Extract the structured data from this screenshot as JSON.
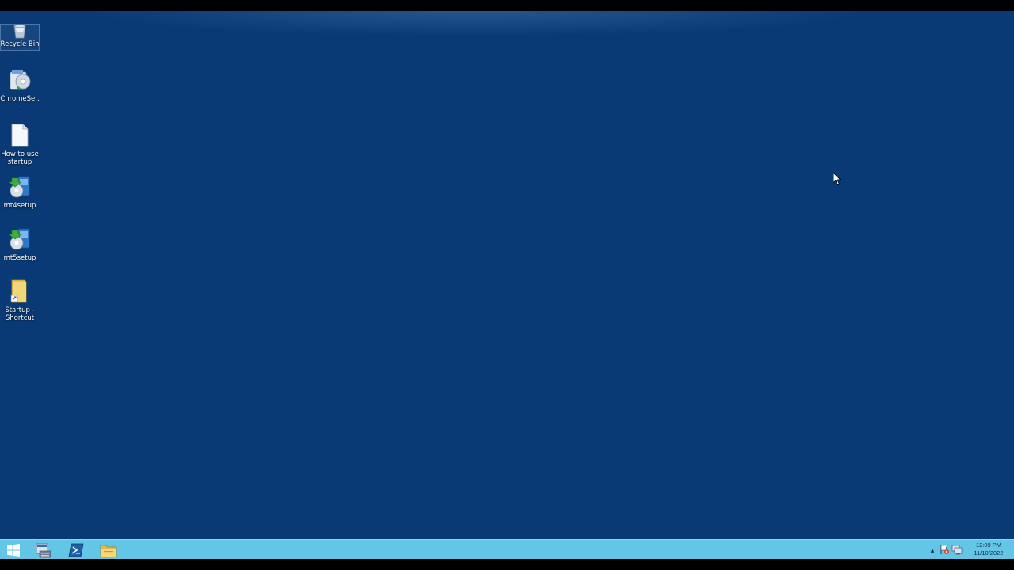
{
  "desktop": {
    "background_color": "#0a3a75",
    "icons": [
      {
        "label": "Recycle Bin",
        "icon": "recycle-bin-icon"
      },
      {
        "label": "ChromeSe...",
        "icon": "chrome-setup-icon"
      },
      {
        "label": "How to use startup",
        "icon": "text-document-icon"
      },
      {
        "label": "mt4setup",
        "icon": "installer-icon"
      },
      {
        "label": "mt5setup",
        "icon": "installer-icon"
      },
      {
        "label": "Startup - Shortcut",
        "icon": "folder-shortcut-icon"
      }
    ]
  },
  "taskbar": {
    "color": "#64c6e6",
    "pinned": [
      {
        "name": "start-button",
        "icon": "windows-logo-icon"
      },
      {
        "name": "server-manager",
        "icon": "server-manager-icon"
      },
      {
        "name": "powershell",
        "icon": "powershell-icon"
      },
      {
        "name": "file-explorer",
        "icon": "folder-icon"
      }
    ],
    "tray": {
      "chevron": "▲",
      "time": "12:09 PM",
      "date": "11/10/2022"
    }
  }
}
